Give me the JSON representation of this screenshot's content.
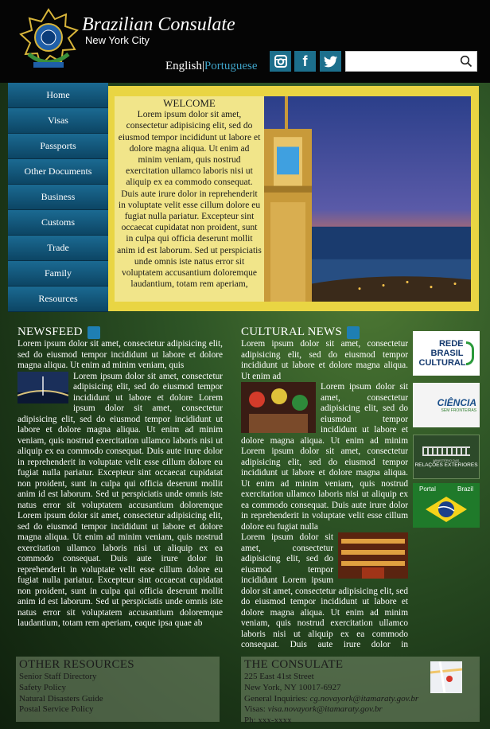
{
  "header": {
    "title": "Brazilian Consulate",
    "subtitle": "New York City",
    "lang_en": "English",
    "lang_sep": "|",
    "lang_pt": "Portuguese",
    "search_placeholder": ""
  },
  "social": [
    {
      "icon": "instagram-icon"
    },
    {
      "icon": "facebook-icon",
      "glyph": "f"
    },
    {
      "icon": "twitter-icon"
    }
  ],
  "nav": [
    "Home",
    "Visas",
    "Passports",
    "Other Documents",
    "Business",
    "Customs",
    "Trade",
    "Family",
    "Resources"
  ],
  "welcome": {
    "heading": "WELCOME",
    "body": "Lorem ipsum dolor sit amet, consectetur adipisicing elit, sed do eiusmod tempor incididunt ut labore et dolore magna aliqua. Ut enim ad minim veniam, quis nostrud exercitation ullamco laboris nisi ut aliquip ex ea commodo consequat. Duis aute irure dolor in reprehenderit in voluptate velit esse cillum dolore eu fugiat nulla pariatur. Excepteur sint occaecat cupidatat non proident, sunt in culpa qui officia deserunt mollit anim id est laborum. Sed ut perspiciatis unde omnis iste natus error sit voluptatem accusantium doloremque laudantium, totam rem aperiam,"
  },
  "newsfeed": {
    "heading": "NEWSFEED",
    "p1": "Lorem ipsum dolor sit amet, consectetur adipisicing elit, sed do eiusmod tempor incididunt ut labore et dolore magna aliqua. Ut enim ad minim veniam, quis",
    "p2": "Lorem ipsum dolor sit amet, consectetur adipisicing elit, sed do eiusmod tempor incididunt ut labore et dolore Lorem ipsum dolor sit amet, consectetur adipisicing elit, sed do eiusmod tempor incididunt ut labore et dolore magna aliqua. Ut enim ad minim veniam, quis nostrud exercitation ullamco laboris nisi ut aliquip ex ea commodo consequat. Duis aute irure dolor in reprehenderit in voluptate velit esse cillum dolore eu fugiat nulla pariatur. Excepteur sint occaecat cupidatat non proident, sunt in culpa qui officia deserunt mollit anim id est laborum. Sed ut perspiciatis unde omnis iste natus error sit voluptatem accusantium doloremque Lorem ipsum dolor sit amet, consectetur adipisicing elit, sed do eiusmod tempor incididunt ut labore et dolore magna aliqua. Ut enim ad minim veniam, quis nostrud exercitation ullamco laboris nisi ut aliquip ex ea commodo consequat. Duis aute irure dolor in reprehenderit in voluptate velit esse cillum dolore eu fugiat nulla pariatur. Excepteur sint occaecat cupidatat non proident, sunt in culpa qui officia deserunt mollit anim id est laborum. Sed ut perspiciatis unde omnis iste natus error sit voluptatem accusantium doloremque laudantium, totam rem aperiam, eaque ipsa quae ab"
  },
  "cultural": {
    "heading": "CULTURAL NEWS",
    "p1": "Lorem ipsum dolor sit amet, consectetur adipisicing elit, sed do eiusmod tempor incididunt ut labore et dolore magna aliqua. Ut enim ad",
    "p2": "Lorem ipsum dolor sit amet, consectetur adipisicing elit, sed do eiusmod tempor incididunt ut labore et dolore magna aliqua. Ut enim ad minim Lorem ipsum dolor sit amet, consectetur adipisicing elit, sed do eiusmod tempor incididunt ut labore et dolore magna aliqua. Ut enim ad minim veniam, quis nostrud exercitation ullamco laboris nisi ut aliquip ex ea commodo consequat. Duis aute irure dolor in reprehenderit in voluptate velit esse cillum dolore eu fugiat nulla",
    "p3": "Lorem ipsum dolor sit amet, consectetur adipisicing elit, sed do eiusmod tempor incididunt Lorem ipsum dolor sit amet, consectetur adipisicing elit, sed do eiusmod tempor incididunt ut labore et dolore magna aliqua. Ut enim ad minim veniam, quis nostrud exercitation ullamco laboris nisi ut aliquip ex ea commodo consequat. Duis aute irure dolor in reprehenderit in voluptate velit esse"
  },
  "sidebar": {
    "rede": "REDE BRASIL CULTURAL",
    "ciencia": "CIÊNCIA",
    "ciencia_sub": "SEM FRONTEIRAS",
    "mre_top": "MINISTÉRIO DAS",
    "mre": "RELAÇÕES EXTERIORES",
    "portal": "Portal",
    "brasil": "Brazil"
  },
  "resources": {
    "heading": "OTHER RESOURCES",
    "items": [
      "Senior Staff Directory",
      "Safety Policy",
      "Natural Disasters Guide",
      "Postal Service Policy"
    ]
  },
  "consulate": {
    "heading": "THE CONSULATE",
    "address1": "225 East 41st Street",
    "address2": "New York, NY 10017-6927",
    "inq_label": "General Inquiries: ",
    "inq": "cg.novayork@itamaraty.gov.br",
    "visa_label": "Visas: ",
    "visa": "visa.novayork@itamaraty.gov.br",
    "phone": "Ph: xxx-xxxx"
  }
}
